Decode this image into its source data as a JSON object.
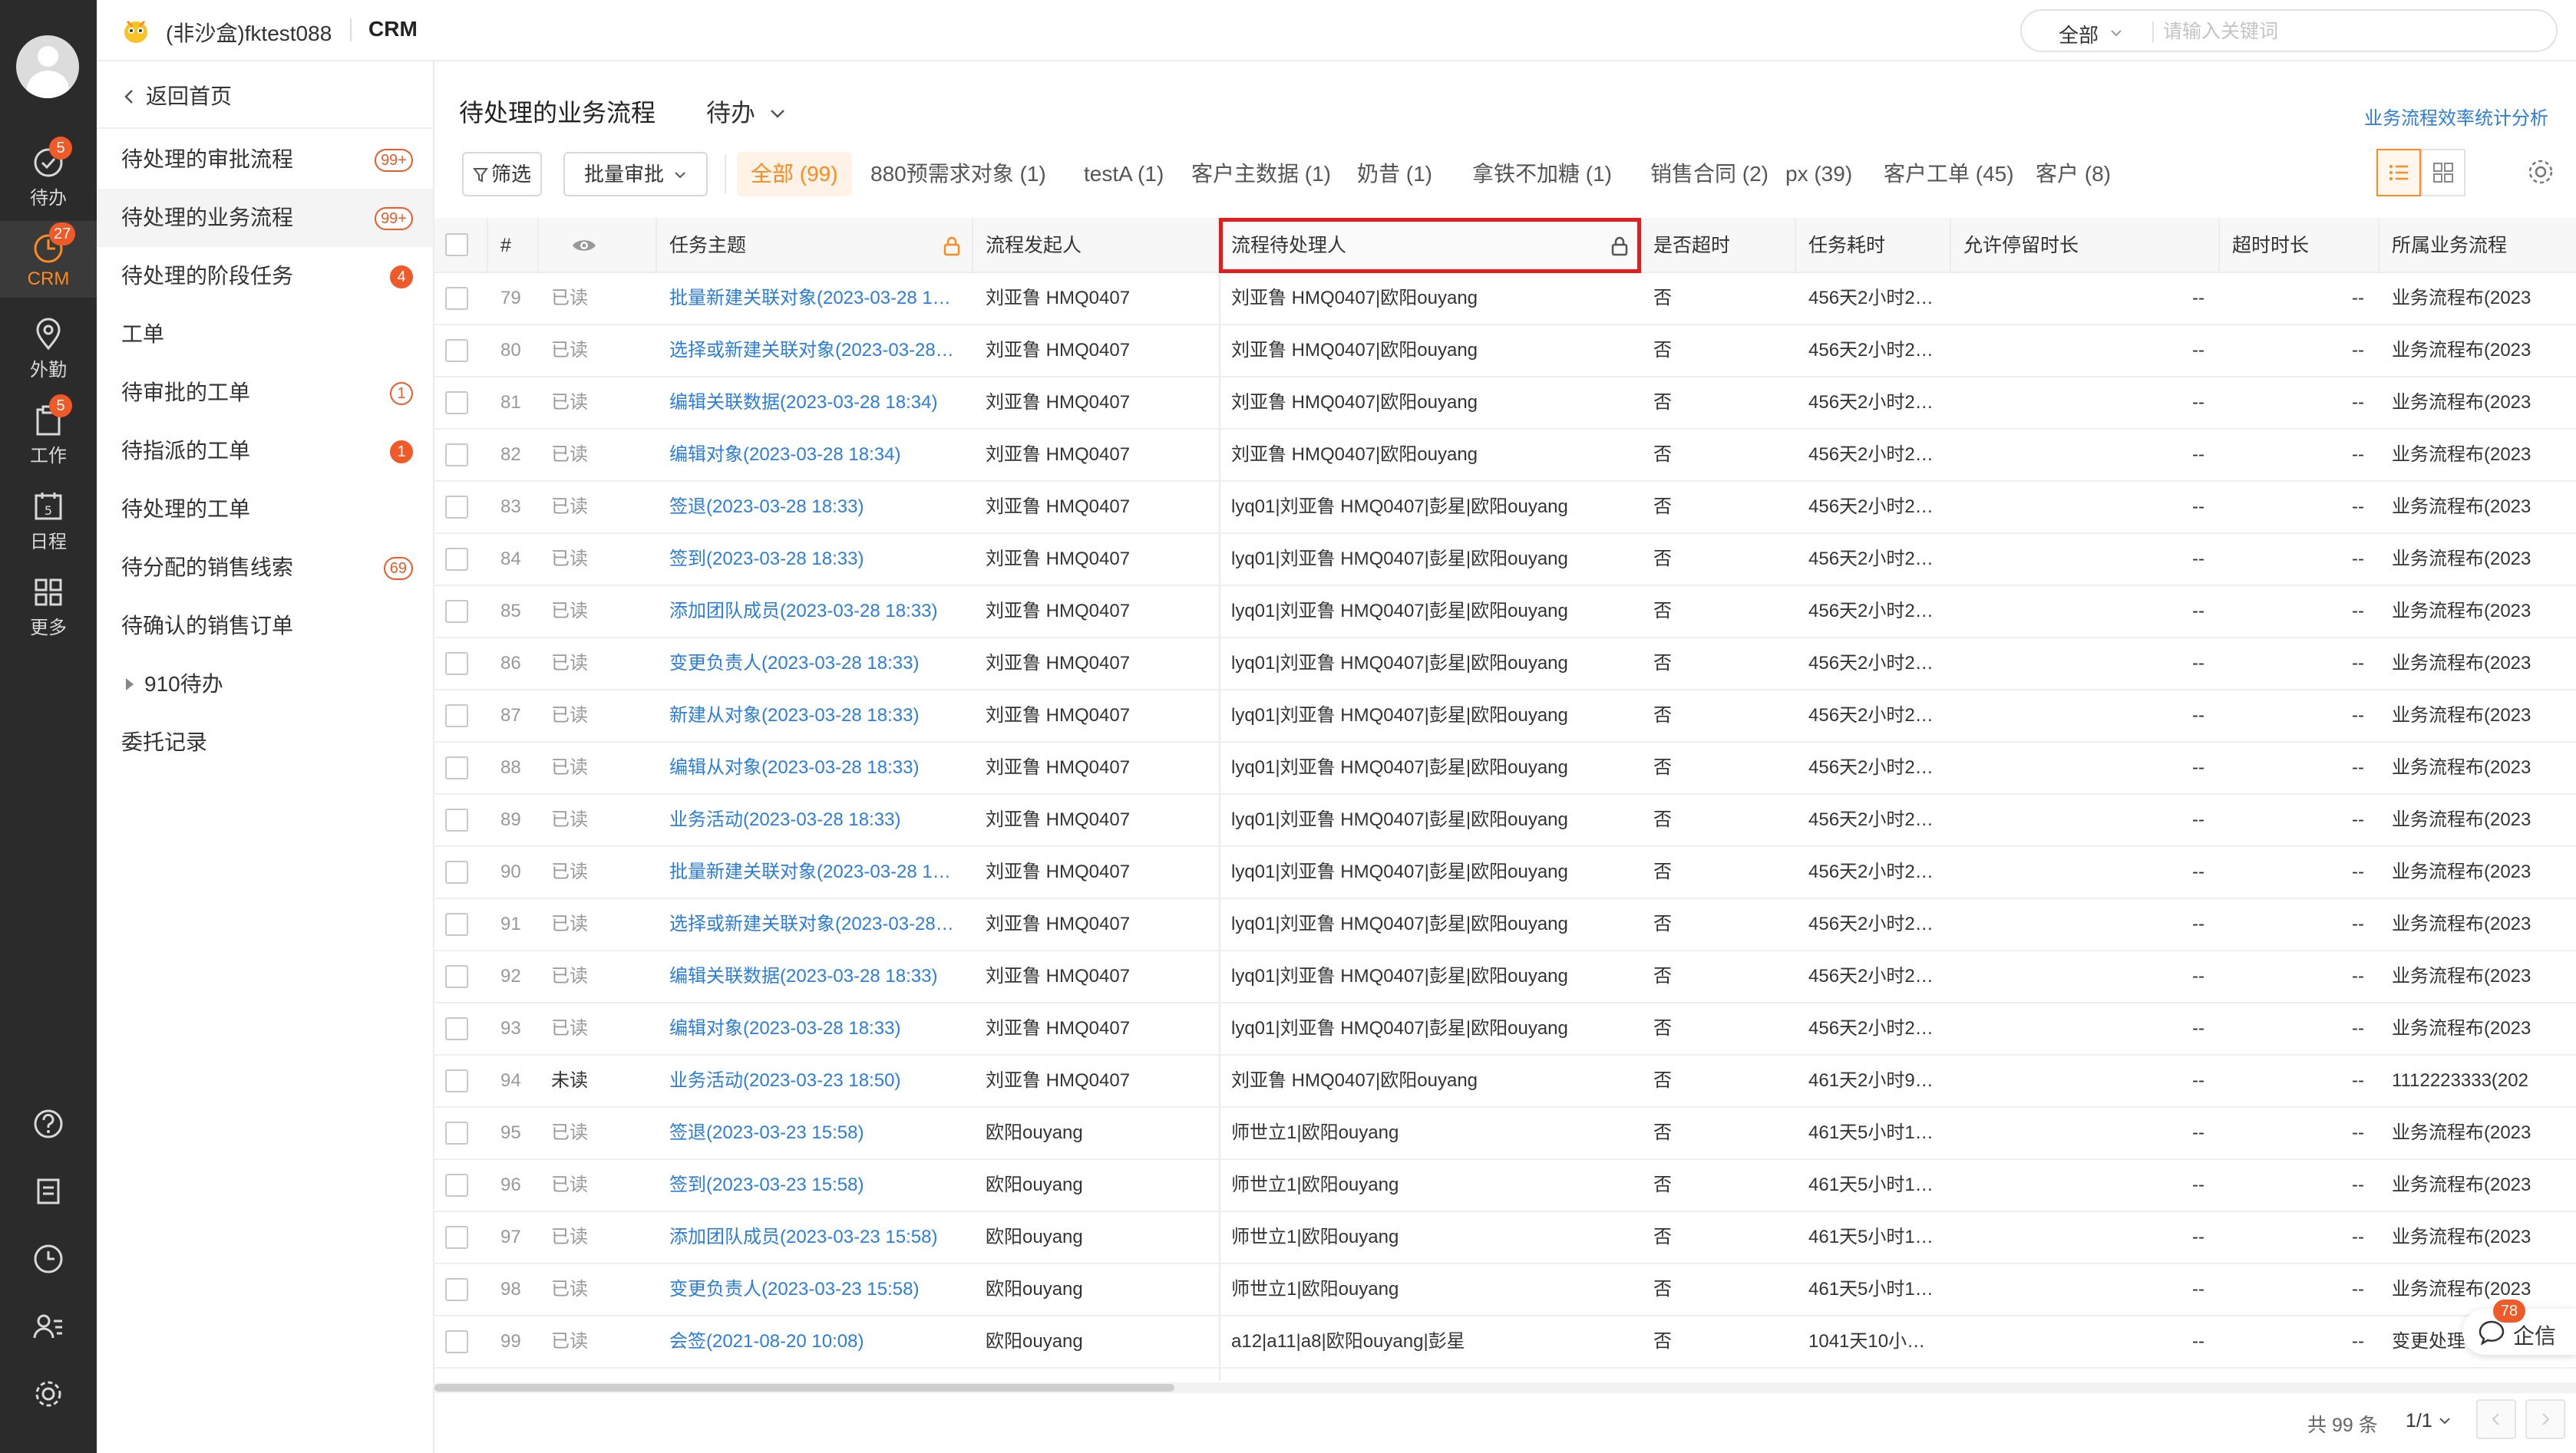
{
  "app": {
    "tenant": "(非沙盒)fktest088",
    "name": "CRM",
    "search_scope": "全部",
    "search_placeholder": "请输入关键词"
  },
  "rail": {
    "items": [
      {
        "label": "待办",
        "badge": "5"
      },
      {
        "label": "CRM",
        "badge": "27"
      },
      {
        "label": "外勤",
        "badge": ""
      },
      {
        "label": "工作",
        "badge": "5"
      },
      {
        "label": "日程",
        "badge": ""
      },
      {
        "label": "更多",
        "badge": ""
      }
    ]
  },
  "sidebar": {
    "back_label": "返回首页",
    "items": [
      {
        "label": "待处理的审批流程",
        "count": "99+",
        "style": "outline"
      },
      {
        "label": "待处理的业务流程",
        "count": "99+",
        "style": "outline"
      },
      {
        "label": "待处理的阶段任务",
        "count": "4",
        "style": "solid"
      },
      {
        "label": "工单",
        "count": "",
        "style": ""
      },
      {
        "label": "待审批的工单",
        "count": "1",
        "style": "outline"
      },
      {
        "label": "待指派的工单",
        "count": "1",
        "style": "solid"
      },
      {
        "label": "待处理的工单",
        "count": "",
        "style": ""
      },
      {
        "label": "待分配的销售线索",
        "count": "69",
        "style": "outline"
      },
      {
        "label": "待确认的销售订单",
        "count": "",
        "style": ""
      },
      {
        "label": "910待办",
        "count": "",
        "style": ""
      },
      {
        "label": "委托记录",
        "count": "",
        "style": ""
      }
    ]
  },
  "main": {
    "title": "待处理的业务流程",
    "view": "待办",
    "stat_link": "业务流程效率统计分析",
    "filter_label": "筛选",
    "batch_label": "批量审批",
    "tabs": [
      "全部 (99)",
      "880预需求对象 (1)",
      "testA (1)",
      "客户主数据 (1)",
      "奶昔 (1)",
      "拿铁不加糖 (1)",
      "销售合同 (2)",
      "px (39)",
      "客户工单 (45)",
      "客户 (8)"
    ],
    "columns": [
      "#",
      "任务主题",
      "流程发起人",
      "流程待处理人",
      "是否超时",
      "任务耗时",
      "允许停留时长",
      "超时时长",
      "所属业务流程"
    ],
    "footer_total": "共 99 条",
    "footer_page": "1/1",
    "qixin_label": "企信",
    "qixin_badge": "78"
  },
  "rows": [
    {
      "n": "79",
      "read": "已读",
      "subject": "批量新建关联对象(2023-03-28 1…",
      "initiator": "刘亚鲁 HMQ0407",
      "handler": "刘亚鲁 HMQ0407|欧阳ouyang",
      "overtime": "否",
      "cost": "456天2小时2…",
      "allow": "--",
      "over": "--",
      "flow": "业务流程布(2023"
    },
    {
      "n": "80",
      "read": "已读",
      "subject": "选择或新建关联对象(2023-03-28…",
      "initiator": "刘亚鲁 HMQ0407",
      "handler": "刘亚鲁 HMQ0407|欧阳ouyang",
      "overtime": "否",
      "cost": "456天2小时2…",
      "allow": "--",
      "over": "--",
      "flow": "业务流程布(2023"
    },
    {
      "n": "81",
      "read": "已读",
      "subject": "编辑关联数据(2023-03-28 18:34)",
      "initiator": "刘亚鲁 HMQ0407",
      "handler": "刘亚鲁 HMQ0407|欧阳ouyang",
      "overtime": "否",
      "cost": "456天2小时2…",
      "allow": "--",
      "over": "--",
      "flow": "业务流程布(2023"
    },
    {
      "n": "82",
      "read": "已读",
      "subject": "编辑对象(2023-03-28 18:34)",
      "initiator": "刘亚鲁 HMQ0407",
      "handler": "刘亚鲁 HMQ0407|欧阳ouyang",
      "overtime": "否",
      "cost": "456天2小时2…",
      "allow": "--",
      "over": "--",
      "flow": "业务流程布(2023"
    },
    {
      "n": "83",
      "read": "已读",
      "subject": "签退(2023-03-28 18:33)",
      "initiator": "刘亚鲁 HMQ0407",
      "handler": "lyq01|刘亚鲁 HMQ0407|彭星|欧阳ouyang",
      "overtime": "否",
      "cost": "456天2小时2…",
      "allow": "--",
      "over": "--",
      "flow": "业务流程布(2023"
    },
    {
      "n": "84",
      "read": "已读",
      "subject": "签到(2023-03-28 18:33)",
      "initiator": "刘亚鲁 HMQ0407",
      "handler": "lyq01|刘亚鲁 HMQ0407|彭星|欧阳ouyang",
      "overtime": "否",
      "cost": "456天2小时2…",
      "allow": "--",
      "over": "--",
      "flow": "业务流程布(2023"
    },
    {
      "n": "85",
      "read": "已读",
      "subject": "添加团队成员(2023-03-28 18:33)",
      "initiator": "刘亚鲁 HMQ0407",
      "handler": "lyq01|刘亚鲁 HMQ0407|彭星|欧阳ouyang",
      "overtime": "否",
      "cost": "456天2小时2…",
      "allow": "--",
      "over": "--",
      "flow": "业务流程布(2023"
    },
    {
      "n": "86",
      "read": "已读",
      "subject": "变更负责人(2023-03-28 18:33)",
      "initiator": "刘亚鲁 HMQ0407",
      "handler": "lyq01|刘亚鲁 HMQ0407|彭星|欧阳ouyang",
      "overtime": "否",
      "cost": "456天2小时2…",
      "allow": "--",
      "over": "--",
      "flow": "业务流程布(2023"
    },
    {
      "n": "87",
      "read": "已读",
      "subject": "新建从对象(2023-03-28 18:33)",
      "initiator": "刘亚鲁 HMQ0407",
      "handler": "lyq01|刘亚鲁 HMQ0407|彭星|欧阳ouyang",
      "overtime": "否",
      "cost": "456天2小时2…",
      "allow": "--",
      "over": "--",
      "flow": "业务流程布(2023"
    },
    {
      "n": "88",
      "read": "已读",
      "subject": "编辑从对象(2023-03-28 18:33)",
      "initiator": "刘亚鲁 HMQ0407",
      "handler": "lyq01|刘亚鲁 HMQ0407|彭星|欧阳ouyang",
      "overtime": "否",
      "cost": "456天2小时2…",
      "allow": "--",
      "over": "--",
      "flow": "业务流程布(2023"
    },
    {
      "n": "89",
      "read": "已读",
      "subject": "业务活动(2023-03-28 18:33)",
      "initiator": "刘亚鲁 HMQ0407",
      "handler": "lyq01|刘亚鲁 HMQ0407|彭星|欧阳ouyang",
      "overtime": "否",
      "cost": "456天2小时2…",
      "allow": "--",
      "over": "--",
      "flow": "业务流程布(2023"
    },
    {
      "n": "90",
      "read": "已读",
      "subject": "批量新建关联对象(2023-03-28 1…",
      "initiator": "刘亚鲁 HMQ0407",
      "handler": "lyq01|刘亚鲁 HMQ0407|彭星|欧阳ouyang",
      "overtime": "否",
      "cost": "456天2小时2…",
      "allow": "--",
      "over": "--",
      "flow": "业务流程布(2023"
    },
    {
      "n": "91",
      "read": "已读",
      "subject": "选择或新建关联对象(2023-03-28…",
      "initiator": "刘亚鲁 HMQ0407",
      "handler": "lyq01|刘亚鲁 HMQ0407|彭星|欧阳ouyang",
      "overtime": "否",
      "cost": "456天2小时2…",
      "allow": "--",
      "over": "--",
      "flow": "业务流程布(2023"
    },
    {
      "n": "92",
      "read": "已读",
      "subject": "编辑关联数据(2023-03-28 18:33)",
      "initiator": "刘亚鲁 HMQ0407",
      "handler": "lyq01|刘亚鲁 HMQ0407|彭星|欧阳ouyang",
      "overtime": "否",
      "cost": "456天2小时2…",
      "allow": "--",
      "over": "--",
      "flow": "业务流程布(2023"
    },
    {
      "n": "93",
      "read": "已读",
      "subject": "编辑对象(2023-03-28 18:33)",
      "initiator": "刘亚鲁 HMQ0407",
      "handler": "lyq01|刘亚鲁 HMQ0407|彭星|欧阳ouyang",
      "overtime": "否",
      "cost": "456天2小时2…",
      "allow": "--",
      "over": "--",
      "flow": "业务流程布(2023"
    },
    {
      "n": "94",
      "read": "未读",
      "subject": "业务活动(2023-03-23 18:50)",
      "initiator": "刘亚鲁 HMQ0407",
      "handler": "刘亚鲁 HMQ0407|欧阳ouyang",
      "overtime": "否",
      "cost": "461天2小时9…",
      "allow": "--",
      "over": "--",
      "flow": "1112223333(202"
    },
    {
      "n": "95",
      "read": "已读",
      "subject": "签退(2023-03-23 15:58)",
      "initiator": "欧阳ouyang",
      "handler": "师世立1|欧阳ouyang",
      "overtime": "否",
      "cost": "461天5小时1…",
      "allow": "--",
      "over": "--",
      "flow": "业务流程布(2023"
    },
    {
      "n": "96",
      "read": "已读",
      "subject": "签到(2023-03-23 15:58)",
      "initiator": "欧阳ouyang",
      "handler": "师世立1|欧阳ouyang",
      "overtime": "否",
      "cost": "461天5小时1…",
      "allow": "--",
      "over": "--",
      "flow": "业务流程布(2023"
    },
    {
      "n": "97",
      "read": "已读",
      "subject": "添加团队成员(2023-03-23 15:58)",
      "initiator": "欧阳ouyang",
      "handler": "师世立1|欧阳ouyang",
      "overtime": "否",
      "cost": "461天5小时1…",
      "allow": "--",
      "over": "--",
      "flow": "业务流程布(2023"
    },
    {
      "n": "98",
      "read": "已读",
      "subject": "变更负责人(2023-03-23 15:58)",
      "initiator": "欧阳ouyang",
      "handler": "师世立1|欧阳ouyang",
      "overtime": "否",
      "cost": "461天5小时1…",
      "allow": "--",
      "over": "--",
      "flow": "业务流程布(2023"
    },
    {
      "n": "99",
      "read": "已读",
      "subject": "会签(2021-08-20 10:08)",
      "initiator": "欧阳ouyang",
      "handler": "a12|a11|a8|欧阳ouyang|彭星",
      "overtime": "否",
      "cost": "1041天10小…",
      "allow": "--",
      "over": "--",
      "flow": "变更处理"
    }
  ],
  "colors": {
    "accent": "#ff8a1f",
    "badge": "#f05a28",
    "link": "#2a7de1",
    "highlight": "#e51c1c",
    "rail": "#2b2b2b"
  }
}
